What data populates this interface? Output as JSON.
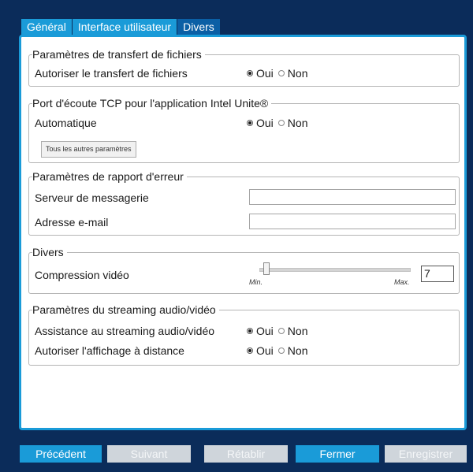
{
  "tabs": [
    "Général",
    "Interface utilisateur",
    "Divers"
  ],
  "active_tab": "Divers",
  "file_transfer": {
    "legend": "Paramètres de transfert de fichiers",
    "label": "Autoriser le transfert de fichiers",
    "yes": "Oui",
    "no": "Non",
    "selected": "Oui"
  },
  "tcp_port": {
    "legend": "Port d'écoute TCP pour l'application Intel Unite®",
    "label": "Automatique",
    "yes": "Oui",
    "no": "Non",
    "selected": "Oui",
    "all_settings_button": "Tous les autres paramètres"
  },
  "error_report": {
    "legend": "Paramètres de rapport d'erreur",
    "mail_server_label": "Serveur de messagerie",
    "mail_server_value": "",
    "email_label": "Adresse e-mail",
    "email_value": ""
  },
  "misc": {
    "legend": "Divers",
    "compression_label": "Compression vidéo",
    "min_label": "Min.",
    "max_label": "Max.",
    "compression_value": "7"
  },
  "streaming": {
    "legend": "Paramètres du streaming audio/vidéo",
    "assist_label": "Assistance au streaming audio/vidéo",
    "assist_yes": "Oui",
    "assist_no": "Non",
    "assist_selected": "Oui",
    "remote_label": "Autoriser l'affichage à distance",
    "remote_yes": "Oui",
    "remote_no": "Non",
    "remote_selected": "Oui"
  },
  "buttons": {
    "previous": "Précédent",
    "next": "Suivant",
    "restore": "Rétablir",
    "close": "Fermer",
    "save": "Enregistrer"
  },
  "colors": {
    "accent": "#1a9bd8",
    "active_tab": "#0b5fa5",
    "background": "#0b2c5a",
    "disabled_button": "#cfd5db"
  }
}
